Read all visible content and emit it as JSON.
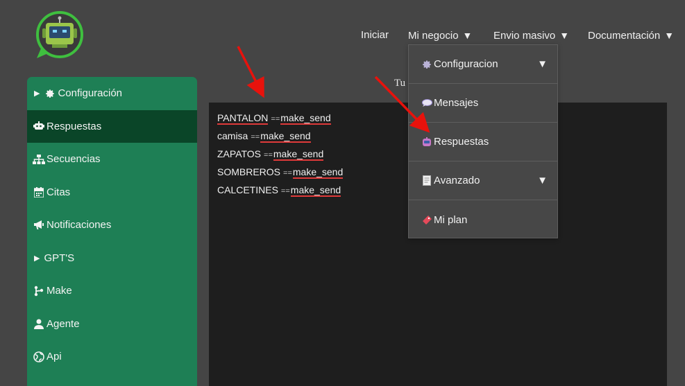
{
  "nav": {
    "items": [
      {
        "label": "Iniciar",
        "has_caret": false
      },
      {
        "label": "Mi negocio",
        "has_caret": true
      },
      {
        "label": "Envio masivo",
        "has_caret": true
      },
      {
        "label": "Documentación",
        "has_caret": true
      }
    ],
    "caret": "▼"
  },
  "dropdown": {
    "items": [
      {
        "label": "Configuracion",
        "icon": "gear-icon",
        "has_caret": true
      },
      {
        "label": "Mensajes",
        "icon": "speech-bubble-icon",
        "has_caret": false
      },
      {
        "label": "Respuestas",
        "icon": "robot-icon",
        "has_caret": false
      },
      {
        "label": "Avanzado",
        "icon": "document-icon",
        "has_caret": true
      },
      {
        "label": "Mi plan",
        "icon": "ticket-icon",
        "has_caret": false
      }
    ]
  },
  "sidebar": {
    "items": [
      {
        "label": "Configuración",
        "icon": "gear-icon",
        "expandable": true,
        "active": false
      },
      {
        "label": "Respuestas",
        "icon": "robot-icon",
        "expandable": false,
        "active": true
      },
      {
        "label": "Secuencias",
        "icon": "sitemap-icon",
        "expandable": false,
        "active": false
      },
      {
        "label": "Citas",
        "icon": "calendar-icon",
        "expandable": false,
        "active": false
      },
      {
        "label": "Notificaciones",
        "icon": "megaphone-icon",
        "expandable": false,
        "active": false
      },
      {
        "label": "GPT'S",
        "icon": "",
        "expandable": true,
        "active": false
      },
      {
        "label": "Make",
        "icon": "branch-icon",
        "expandable": false,
        "active": false
      },
      {
        "label": "Agente",
        "icon": "user-icon",
        "expandable": false,
        "active": false
      },
      {
        "label": "Api",
        "icon": "globe-icon",
        "expandable": false,
        "active": false
      }
    ]
  },
  "header_text": "Tu",
  "editor": {
    "lines": [
      {
        "keyword": "PANTALON",
        "separator": "==",
        "value": "make_send"
      },
      {
        "keyword": "camisa",
        "separator": "==",
        "value": "make_send"
      },
      {
        "keyword": "ZAPATOS",
        "separator": "==",
        "value": "make_send"
      },
      {
        "keyword": "SOMBREROS",
        "separator": "==",
        "value": "make_send"
      },
      {
        "keyword": "CALCETINES",
        "separator": "==",
        "value": "make_send"
      }
    ]
  },
  "colors": {
    "background": "#454545",
    "sidebar": "#1e7f55",
    "sidebar_active": "#0a4528",
    "editor_bg": "#1e1e1e",
    "annotation_arrow": "#e8120c",
    "underline": "#e03a3a"
  }
}
